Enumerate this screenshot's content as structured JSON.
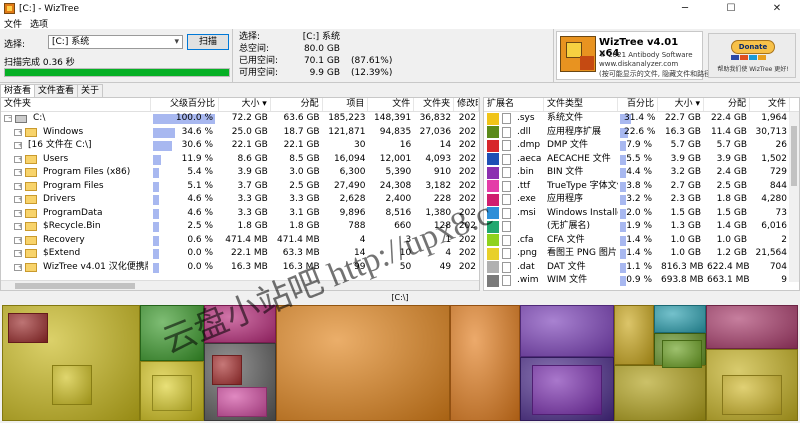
{
  "window": {
    "title": "[C:] - WizTree",
    "min": "─",
    "max": "☐",
    "close": "✕"
  },
  "menu": [
    "文件",
    "选项"
  ],
  "top": {
    "select_label": "选择:",
    "drive_value": "[C:] 系统",
    "scan_button": "扫描",
    "scan_status": "扫描完成 0.36 秒",
    "progress": 1.0,
    "stats": [
      {
        "k": "选择:",
        "v": "[C:] 系统",
        "p": ""
      },
      {
        "k": "总空间:",
        "v": "80.0 GB",
        "p": ""
      },
      {
        "k": "已用空间:",
        "v": "70.1 GB",
        "p": "(87.61%)"
      },
      {
        "k": "可用空间:",
        "v": "9.9 GB",
        "p": "(12.39%)"
      }
    ]
  },
  "brand": {
    "name": "WizTree v4.01 x64",
    "line1": "© 2021 Antibody Software",
    "line2": "www.diskanalyzer.com",
    "line3": "(按可能显示的文件, 隐藏文件和路径)"
  },
  "donate": {
    "button": "Donate",
    "text": "帮助我们使 WizTree 更好!"
  },
  "tabs": [
    "树查看",
    "文件查看",
    "关于"
  ],
  "tree": {
    "headers": [
      "文件夹",
      "父级百分比",
      "大小 ▾",
      "分配",
      "项目",
      "文件",
      "文件夹",
      "修改时"
    ],
    "rows": [
      {
        "icon": "drive",
        "exp": "−",
        "name": "C:\\",
        "pct": 100.0,
        "pct_t": "100.0 %",
        "size": "72.2 GB",
        "alloc": "63.6 GB",
        "items": "185,223",
        "files": "148,391",
        "folders": "36,832",
        "mod": "202"
      },
      {
        "icon": "folder",
        "exp": "+",
        "name": "Windows",
        "pct": 34.6,
        "pct_t": "34.6 %",
        "size": "25.0 GB",
        "alloc": "18.7 GB",
        "items": "121,871",
        "files": "94,835",
        "folders": "27,036",
        "mod": "202"
      },
      {
        "icon": "none",
        "exp": "+",
        "name": "[16 文件在 C:\\]",
        "pct": 30.6,
        "pct_t": "30.6 %",
        "size": "22.1 GB",
        "alloc": "22.1 GB",
        "items": "30",
        "files": "16",
        "folders": "14",
        "mod": "202"
      },
      {
        "icon": "folder",
        "exp": "+",
        "name": "Users",
        "pct": 11.9,
        "pct_t": "11.9 %",
        "size": "8.6 GB",
        "alloc": "8.5 GB",
        "items": "16,094",
        "files": "12,001",
        "folders": "4,093",
        "mod": "202"
      },
      {
        "icon": "folder",
        "exp": "+",
        "name": "Program Files (x86)",
        "pct": 5.4,
        "pct_t": "5.4 %",
        "size": "3.9 GB",
        "alloc": "3.0 GB",
        "items": "6,300",
        "files": "5,390",
        "folders": "910",
        "mod": "202"
      },
      {
        "icon": "folder",
        "exp": "+",
        "name": "Program Files",
        "pct": 5.1,
        "pct_t": "5.1 %",
        "size": "3.7 GB",
        "alloc": "2.5 GB",
        "items": "27,490",
        "files": "24,308",
        "folders": "3,182",
        "mod": "202"
      },
      {
        "icon": "folder",
        "exp": "+",
        "name": "Drivers",
        "pct": 4.6,
        "pct_t": "4.6 %",
        "size": "3.3 GB",
        "alloc": "3.3 GB",
        "items": "2,628",
        "files": "2,400",
        "folders": "228",
        "mod": "202"
      },
      {
        "icon": "folder",
        "exp": "+",
        "name": "ProgramData",
        "pct": 4.6,
        "pct_t": "4.6 %",
        "size": "3.3 GB",
        "alloc": "3.1 GB",
        "items": "9,896",
        "files": "8,516",
        "folders": "1,380",
        "mod": "202"
      },
      {
        "icon": "folder",
        "exp": "+",
        "name": "$Recycle.Bin",
        "pct": 2.5,
        "pct_t": "2.5 %",
        "size": "1.8 GB",
        "alloc": "1.8 GB",
        "items": "788",
        "files": "660",
        "folders": "128",
        "mod": "202"
      },
      {
        "icon": "folder",
        "exp": "+",
        "name": "Recovery",
        "pct": 0.6,
        "pct_t": "0.6 %",
        "size": "471.4 MB",
        "alloc": "471.4 MB",
        "items": "4",
        "files": "3",
        "folders": "1",
        "mod": "202"
      },
      {
        "icon": "folder",
        "exp": "+",
        "name": "$Extend",
        "pct": 0.0,
        "pct_t": "0.0 %",
        "size": "22.1 MB",
        "alloc": "63.3 MB",
        "items": "14",
        "files": "10",
        "folders": "4",
        "mod": "202"
      },
      {
        "icon": "folder",
        "exp": "+",
        "name": "WizTree v4.01 汉化便携版（破",
        "pct": 0.0,
        "pct_t": "0.0 %",
        "size": "16.3 MB",
        "alloc": "16.3 MB",
        "items": "99",
        "files": "50",
        "folders": "49",
        "mod": "202"
      }
    ]
  },
  "exts": {
    "headers": [
      "扩展名",
      "文件类型",
      "百分比",
      "大小 ▾",
      "分配",
      "文件"
    ],
    "rows": [
      {
        "color": "#f0c419",
        "ext": ".sys",
        "type": "系统文件",
        "pct": 31.4,
        "pct_t": "31.4 %",
        "size": "22.7 GB",
        "alloc": "22.4 GB",
        "files": "1,964"
      },
      {
        "color": "#5b8a1a",
        "ext": ".dll",
        "type": "应用程序扩展",
        "pct": 22.6,
        "pct_t": "22.6 %",
        "size": "16.3 GB",
        "alloc": "11.4 GB",
        "files": "30,713"
      },
      {
        "color": "#d7262b",
        "ext": ".dmp",
        "type": "DMP 文件",
        "pct": 7.9,
        "pct_t": "7.9 %",
        "size": "5.7 GB",
        "alloc": "5.7 GB",
        "files": "26"
      },
      {
        "color": "#1e4fb5",
        "ext": ".aecach",
        "type": "AECACHE 文件",
        "pct": 5.5,
        "pct_t": "5.5 %",
        "size": "3.9 GB",
        "alloc": "3.9 GB",
        "files": "1,502"
      },
      {
        "color": "#8c2fb0",
        "ext": ".bin",
        "type": "BIN 文件",
        "pct": 4.4,
        "pct_t": "4.4 %",
        "size": "3.2 GB",
        "alloc": "2.4 GB",
        "files": "729"
      },
      {
        "color": "#e43ca8",
        "ext": ".ttf",
        "type": "TrueType 字体文件",
        "pct": 3.8,
        "pct_t": "3.8 %",
        "size": "2.7 GB",
        "alloc": "2.5 GB",
        "files": "844"
      },
      {
        "color": "#d01e6e",
        "ext": ".exe",
        "type": "应用程序",
        "pct": 3.2,
        "pct_t": "3.2 %",
        "size": "2.3 GB",
        "alloc": "1.8 GB",
        "files": "4,280"
      },
      {
        "color": "#2d8fd8",
        "ext": ".msi",
        "type": "Windows Installer",
        "pct": 2.0,
        "pct_t": "2.0 %",
        "size": "1.5 GB",
        "alloc": "1.5 GB",
        "files": "73"
      },
      {
        "color": "#22a870",
        "ext": "",
        "type": "(无扩展名)",
        "pct": 1.9,
        "pct_t": "1.9 %",
        "size": "1.3 GB",
        "alloc": "1.4 GB",
        "files": "6,016"
      },
      {
        "color": "#8fd21e",
        "ext": ".cfa",
        "type": "CFA 文件",
        "pct": 1.4,
        "pct_t": "1.4 %",
        "size": "1.0 GB",
        "alloc": "1.0 GB",
        "files": "2"
      },
      {
        "color": "#e8d02a",
        "ext": ".png",
        "type": "看图王 PNG 图片",
        "pct": 1.4,
        "pct_t": "1.4 %",
        "size": "1.0 GB",
        "alloc": "1.2 GB",
        "files": "21,564"
      },
      {
        "color": "#b0b0b0",
        "ext": ".dat",
        "type": "DAT 文件",
        "pct": 1.1,
        "pct_t": "1.1 %",
        "size": "816.3 MB",
        "alloc": "622.4 MB",
        "files": "704"
      },
      {
        "color": "#7a7a7a",
        "ext": ".wim",
        "type": "WIM 文件",
        "pct": 0.9,
        "pct_t": "0.9 %",
        "size": "693.8 MB",
        "alloc": "663.1 MB",
        "files": "9"
      }
    ]
  },
  "treemap_path": "[C:\\]",
  "watermark": "云盘小站吧 http://upx8.c"
}
